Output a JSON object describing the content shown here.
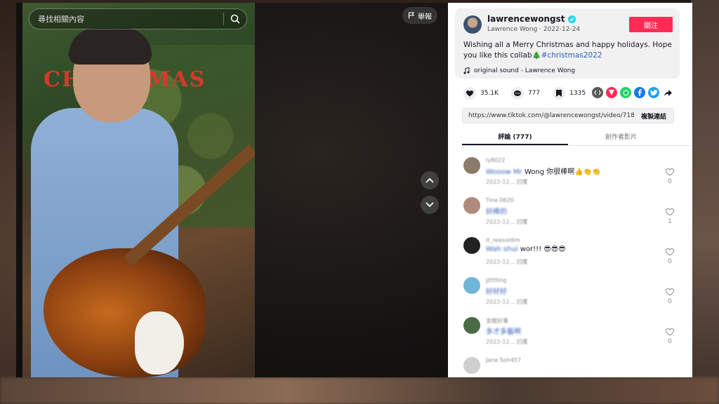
{
  "search": {
    "placeholder": "尋找相關內容"
  },
  "report": {
    "label": "舉報"
  },
  "video": {
    "sign_text": "CHRISTMAS"
  },
  "post": {
    "username": "lawrencewongst",
    "display_name": "Lawrence Wong",
    "date": "2022-12-24",
    "follow_label": "關注",
    "caption_text": "Wishing all a Merry Christmas and happy holidays. Hope you like this collab",
    "caption_emoji": "🎄",
    "hashtag": "#christmas2022",
    "sound": "original sound - Lawrence Wong"
  },
  "actions": {
    "likes": "35.1K",
    "comments": "777",
    "saves": "1335"
  },
  "share_icons": [
    {
      "name": "embed-icon",
      "color": "#5a5a5a"
    },
    {
      "name": "send-to-friends-icon",
      "color": "#fe2c55"
    },
    {
      "name": "whatsapp-icon",
      "color": "#25d366"
    },
    {
      "name": "facebook-icon",
      "color": "#1877f2"
    },
    {
      "name": "twitter-icon",
      "color": "#1da1f2"
    },
    {
      "name": "share-arrow-icon",
      "color": "#161823"
    }
  ],
  "link": {
    "url": "https://www.tiktok.com/@lawrencewongst/video/7180...",
    "copy_label": "複製連結"
  },
  "tabs": [
    {
      "label": "評論 (777)"
    },
    {
      "label": "創作者影片"
    }
  ],
  "comments": [
    {
      "user": "ly8022",
      "text_blur": "Wooow Mr",
      "text": " Wong 你很棒啊👍👏👏",
      "meta": "2022-12... 回覆",
      "likes": "0",
      "avatar_color": "#8c7a6a"
    },
    {
      "user": "Tina 0620",
      "text_blur": "好棒的",
      "text": "",
      "meta": "2022-12... 回覆",
      "likes": "1",
      "avatar_color": "#b08a7a"
    },
    {
      "user": "it_reasoldim",
      "text_blur": "Wah shui",
      "text": " wor!!! 😎😎😎",
      "meta": "2022-12... 回覆",
      "likes": "0",
      "avatar_color": "#222222"
    },
    {
      "user": "jjtttting",
      "text_blur": "好好好",
      "text": "",
      "meta": "2022-12... 回覆",
      "likes": "0",
      "avatar_color": "#6fb6d8"
    },
    {
      "user": "金龍好事",
      "text_blur": "多才多藝啊",
      "text": "",
      "meta": "2022-12... 回覆",
      "likes": "0",
      "avatar_color": "#4b6b45"
    },
    {
      "user": "Jane Soh457",
      "text_blur": "",
      "text": "",
      "meta": "",
      "likes": "",
      "avatar_color": "#cfcfcf"
    }
  ]
}
